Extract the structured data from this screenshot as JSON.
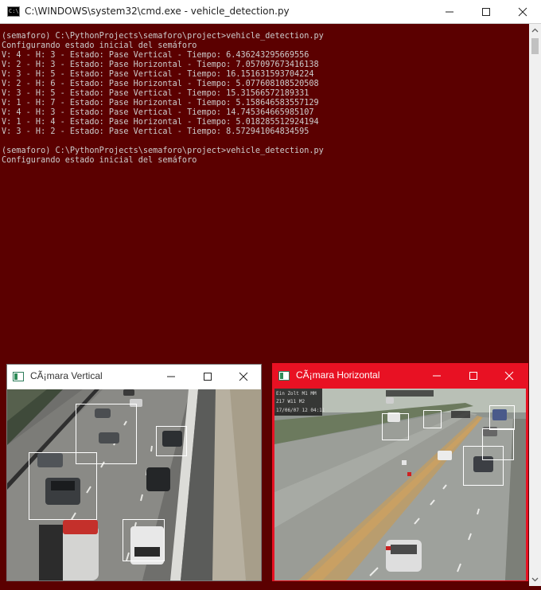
{
  "terminal": {
    "title": "C:\\WINDOWS\\system32\\cmd.exe - vehicle_detection.py",
    "icon": "cmd-icon",
    "lines": [
      "(semaforo) C:\\PythonProjects\\semaforo\\project>vehicle_detection.py",
      "Configurando estado inicial del semáforo",
      "V: 4 - H: 3 - Estado: Pase Vertical - Tiempo: 6.436243295669556",
      "V: 2 - H: 3 - Estado: Pase Horizontal - Tiempo: 7.057097673416138",
      "V: 3 - H: 5 - Estado: Pase Vertical - Tiempo: 16.151631593704224",
      "V: 2 - H: 6 - Estado: Pase Horizontal - Tiempo: 5.077608108520508",
      "V: 3 - H: 5 - Estado: Pase Vertical - Tiempo: 15.31566572189331",
      "V: 1 - H: 7 - Estado: Pase Horizontal - Tiempo: 5.158646583557129",
      "V: 4 - H: 3 - Estado: Pase Vertical - Tiempo: 14.745364665985107",
      "V: 1 - H: 4 - Estado: Pase Horizontal - Tiempo: 5.018285512924194",
      "V: 3 - H: 2 - Estado: Pase Vertical - Tiempo: 8.572941064834595",
      "",
      "(semaforo) C:\\PythonProjects\\semaforo\\project>vehicle_detection.py",
      "Configurando estado inicial del semáforo"
    ],
    "background": "#5b0000",
    "text_color": "#cccccc"
  },
  "vertical_window": {
    "title": "CÃ¡mara Vertical",
    "state": "inactive",
    "detections": 4
  },
  "horizontal_window": {
    "title": "CÃ¡mara Horizontal",
    "state": "active",
    "accent": "#e81123",
    "overlay_lines": [
      "Ein Zolt M1 MM",
      "Z17 W11 M2",
      "17/06/07 12 04:11"
    ],
    "detections": 4
  }
}
